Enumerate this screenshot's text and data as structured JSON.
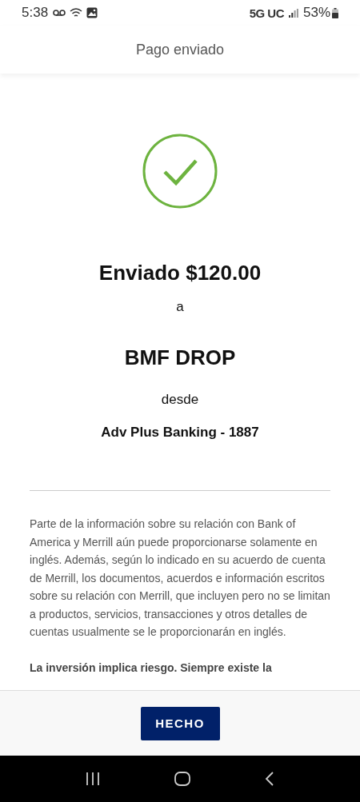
{
  "status_bar": {
    "time": "5:38",
    "network": "5G UC",
    "battery": "53%"
  },
  "header": {
    "title": "Pago enviado"
  },
  "confirmation": {
    "amount_line": "Enviado $120.00",
    "to_label": "a",
    "recipient": "BMF DROP",
    "from_label": "desde",
    "account": "Adv Plus Banking - 1887"
  },
  "disclosures": [
    "Parte de la información sobre su relación con Bank of America y Merrill aún puede proporcionarse solamente en inglés. Además, según lo indicado en su acuerdo de cuenta de Merrill, los documentos, acuerdos e información escritos sobre su relación con Merrill, que incluyen pero no se limitan a productos, servicios, transacciones y otros detalles de cuentas usualmente se le proporcionarán en inglés.",
    "**La inversión implica riesgo. Siempre existe la**"
  ],
  "footer": {
    "button": "HECHO"
  }
}
